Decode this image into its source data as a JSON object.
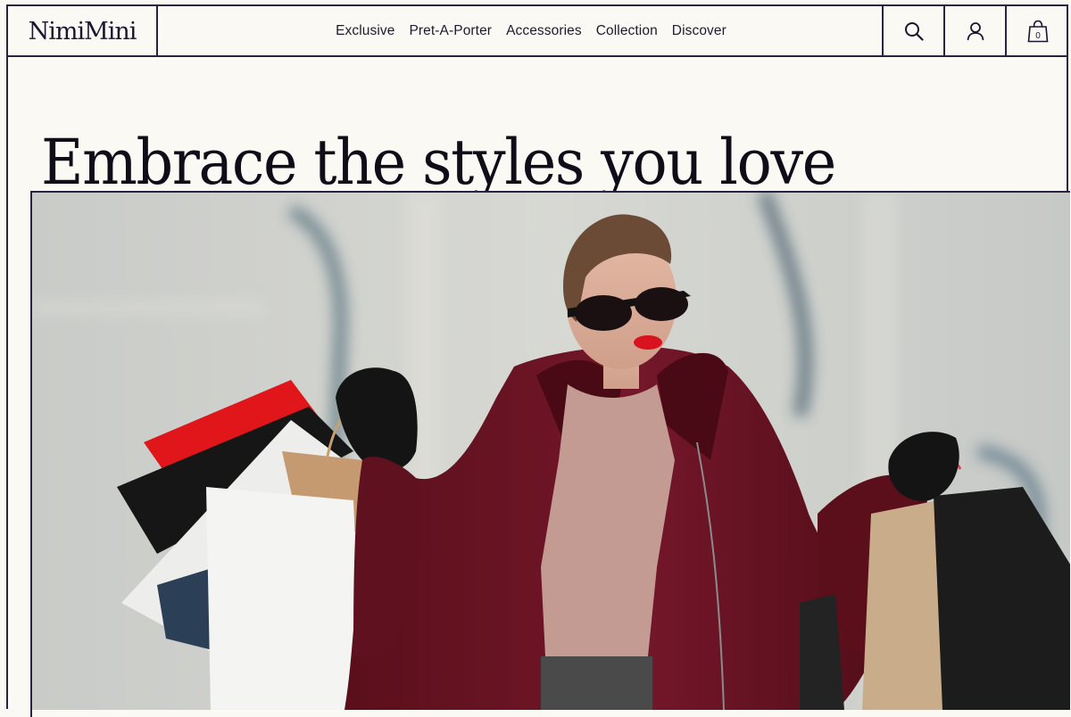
{
  "brand": {
    "logo_text": "NimiMini"
  },
  "nav": {
    "items": [
      {
        "label": "Exclusive"
      },
      {
        "label": "Pret-A-Porter"
      },
      {
        "label": "Accessories"
      },
      {
        "label": "Collection"
      },
      {
        "label": "Discover"
      }
    ]
  },
  "header_actions": {
    "search_icon": "search-icon",
    "account_icon": "user-icon",
    "cart_icon": "shopping-bag-icon",
    "cart_count": "0"
  },
  "hero": {
    "title": "Embrace the styles you love"
  },
  "colors": {
    "border": "#2a2440",
    "background": "#fbf9f4",
    "coat": "#6e1522",
    "lips": "#d8121f",
    "bag_red": "#e0161a"
  }
}
